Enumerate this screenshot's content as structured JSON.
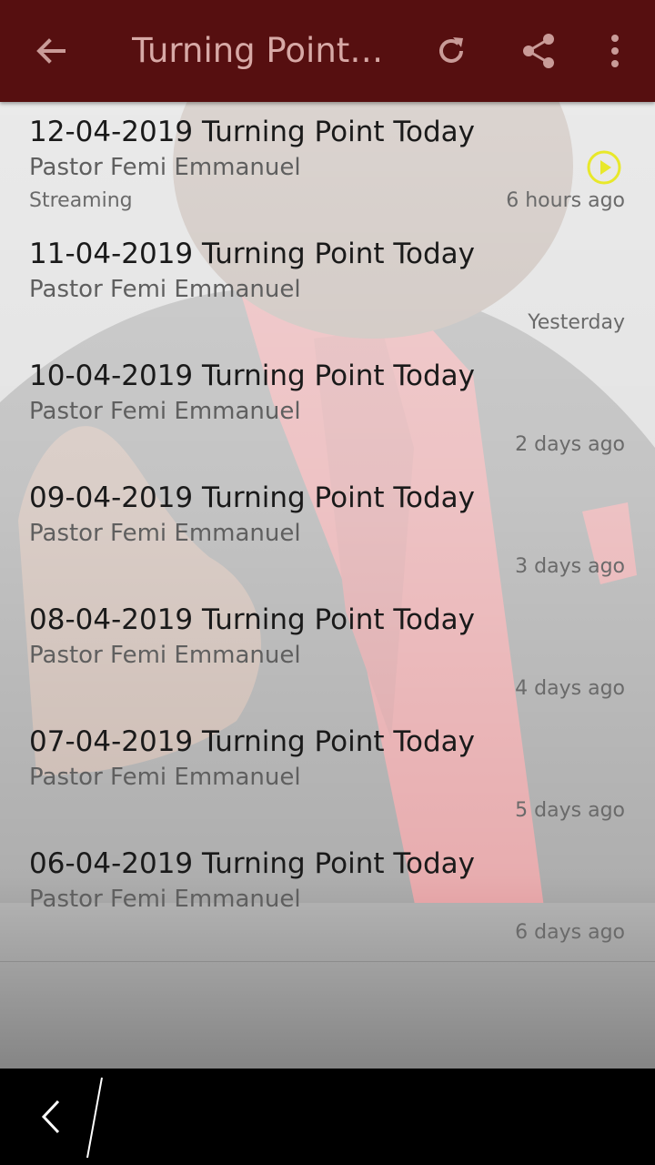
{
  "toolbar": {
    "title": "Turning Point…",
    "icons": {
      "back": "back-arrow-icon",
      "refresh": "refresh-icon",
      "share": "share-icon",
      "more": "more-vert-icon"
    },
    "colors": {
      "background": "#560f10",
      "title": "#d7a9a6",
      "icons": "#c99b98"
    }
  },
  "items": [
    {
      "title": "12-04-2019 Turning Point Today",
      "author": "Pastor Femi Emmanuel",
      "status": "Streaming",
      "time": "6 hours ago",
      "playing": true
    },
    {
      "title": "11-04-2019 Turning Point Today",
      "author": "Pastor Femi Emmanuel",
      "status": "",
      "time": "Yesterday"
    },
    {
      "title": "10-04-2019 Turning Point Today",
      "author": "Pastor Femi Emmanuel",
      "status": "",
      "time": "2 days ago"
    },
    {
      "title": "09-04-2019 Turning Point Today",
      "author": "Pastor Femi Emmanuel",
      "status": "",
      "time": "3 days ago"
    },
    {
      "title": "08-04-2019 Turning Point Today",
      "author": "Pastor Femi Emmanuel",
      "status": "",
      "time": "4 days ago"
    },
    {
      "title": "07-04-2019 Turning Point Today",
      "author": "Pastor Femi Emmanuel",
      "status": "",
      "time": "5 days ago"
    },
    {
      "title": "06-04-2019 Turning Point Today",
      "author": "Pastor Femi Emmanuel",
      "status": "",
      "time": "6 days ago"
    }
  ],
  "play_icon_color": "#e8e82a",
  "navbar": {
    "icons": {
      "back": "nav-back-icon"
    }
  }
}
